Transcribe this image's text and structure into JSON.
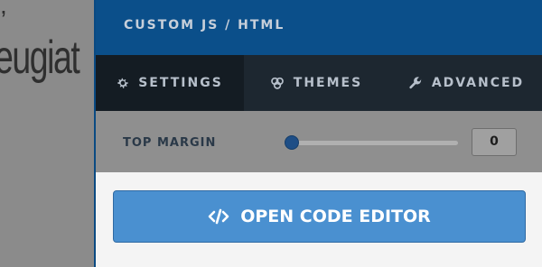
{
  "background": {
    "top_text": ",",
    "text": "eugiat"
  },
  "panel": {
    "title": "CUSTOM JS / HTML",
    "tabs": [
      {
        "label": "SETTINGS",
        "icon": "gear-icon"
      },
      {
        "label": "THEMES",
        "icon": "palette-icon"
      },
      {
        "label": "ADVANCED",
        "icon": "wrench-icon"
      }
    ],
    "top_margin": {
      "label": "TOP MARGIN",
      "value": "0",
      "slider_fraction": 0
    },
    "editor_button": {
      "label": "OPEN CODE EDITOR",
      "icon": "code-icon"
    }
  },
  "colors": {
    "header": "#0b4f8a",
    "tabs_bar": "#1d2730",
    "active_tab": "#141c23",
    "button": "#4a90d0"
  }
}
